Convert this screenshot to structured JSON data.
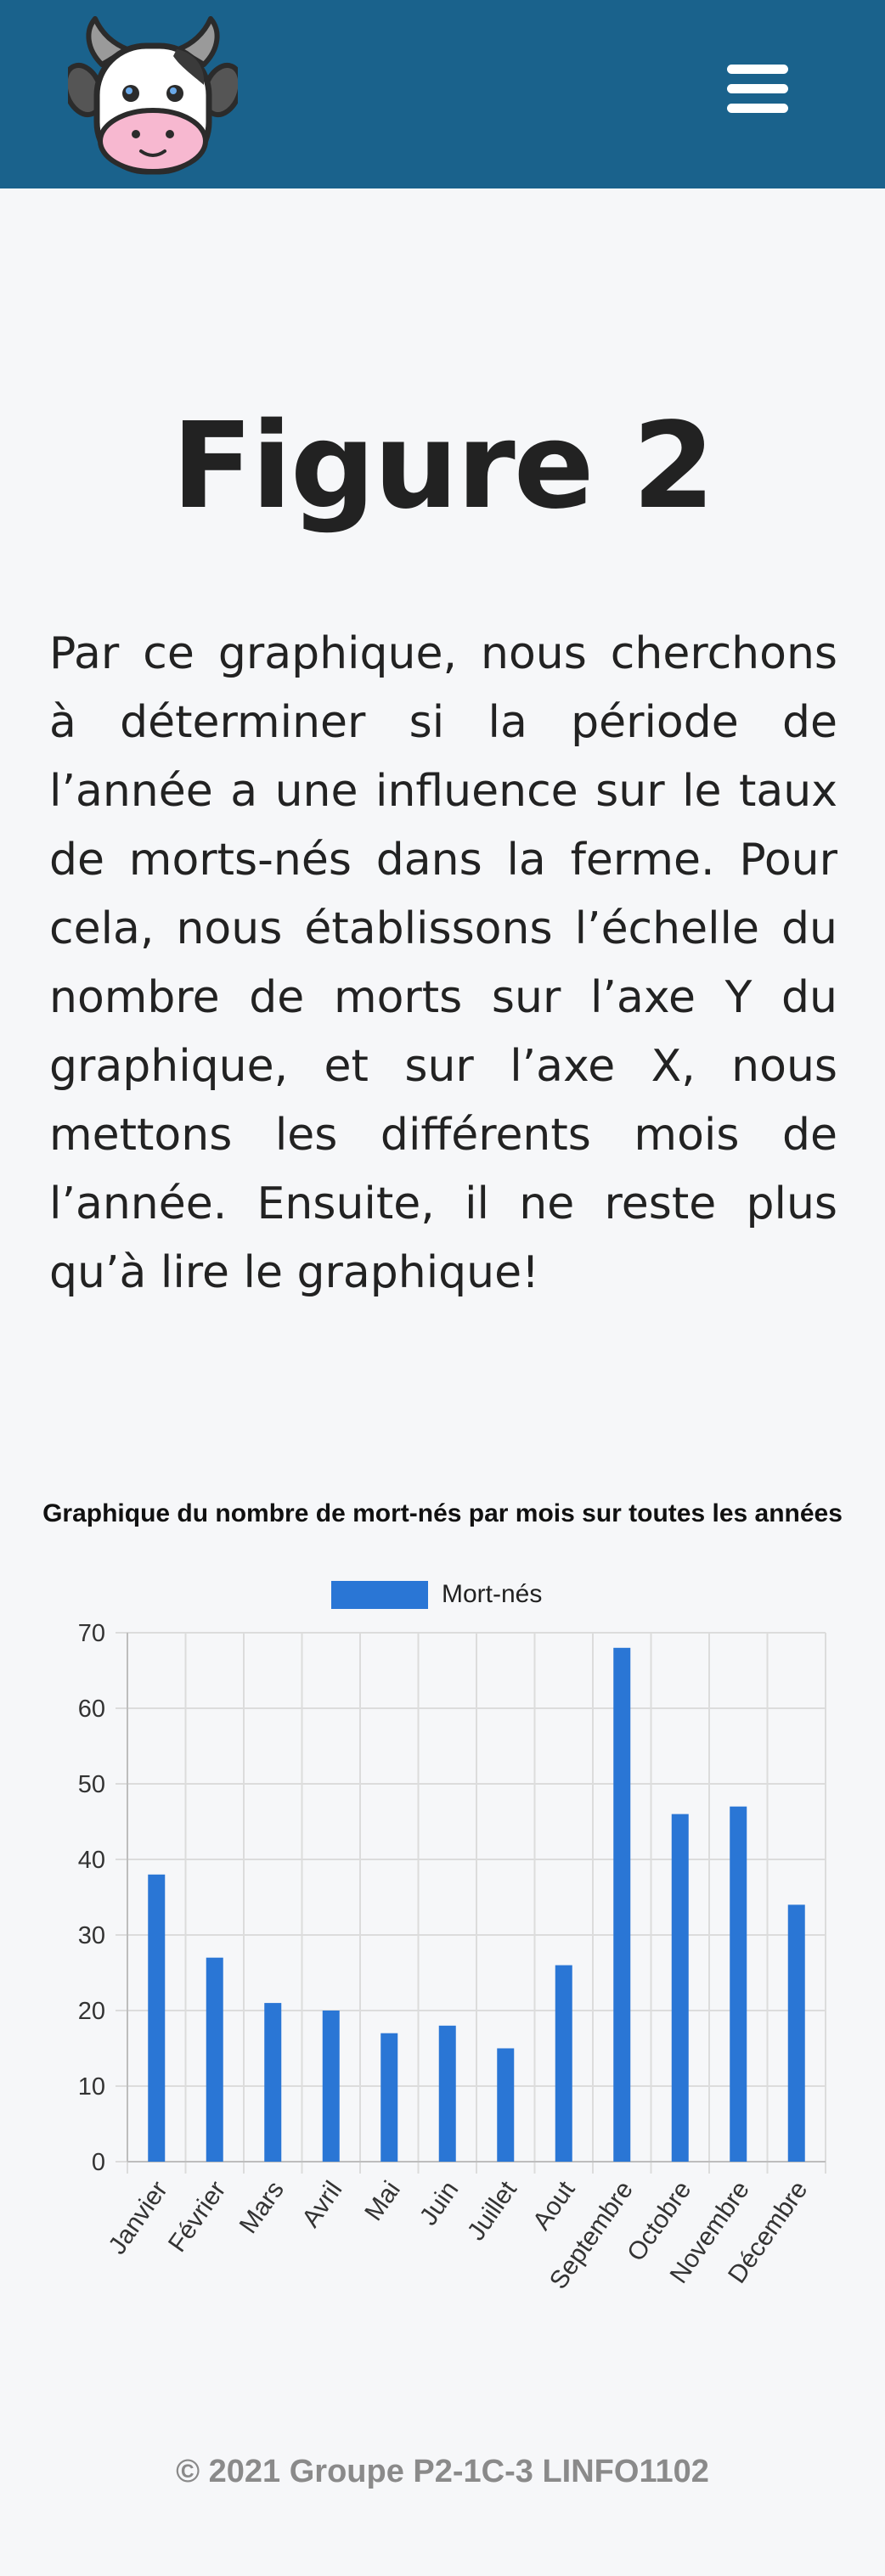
{
  "header": {
    "logo_icon": "cow-face-icon",
    "menu_icon": "hamburger-menu-icon",
    "background_color": "#1a628c"
  },
  "main": {
    "title": "Figure 2",
    "intro": "Par ce graphique, nous cherchons à déterminer si la période de l’année a une influence sur le taux de morts-nés dans la ferme. Pour cela, nous établissons l’échelle du nombre de morts sur l’axe Y du graphique, et sur l’axe X, nous mettons les différents mois de l’année. Ensuite, il ne reste plus qu’à lire le graphique!"
  },
  "chart_data": {
    "type": "bar",
    "title": "Graphique du nombre de mort-nés par mois sur toutes les années",
    "xlabel": "",
    "ylabel": "",
    "categories": [
      "Janvier",
      "Février",
      "Mars",
      "Avril",
      "Mai",
      "Juin",
      "Juillet",
      "Aout",
      "Septembre",
      "Octobre",
      "Novembre",
      "Décembre"
    ],
    "series": [
      {
        "name": "Mort-nés",
        "color": "#2a76d5",
        "values": [
          38,
          27,
          21,
          20,
          17,
          18,
          15,
          26,
          68,
          46,
          47,
          34
        ]
      }
    ],
    "ylim": [
      0,
      70
    ],
    "yticks": [
      0,
      10,
      20,
      30,
      40,
      50,
      60,
      70
    ],
    "grid": true,
    "legend_position": "top"
  },
  "footer": {
    "text": "© 2021 Groupe P2-1C-3 LINFO1102"
  }
}
